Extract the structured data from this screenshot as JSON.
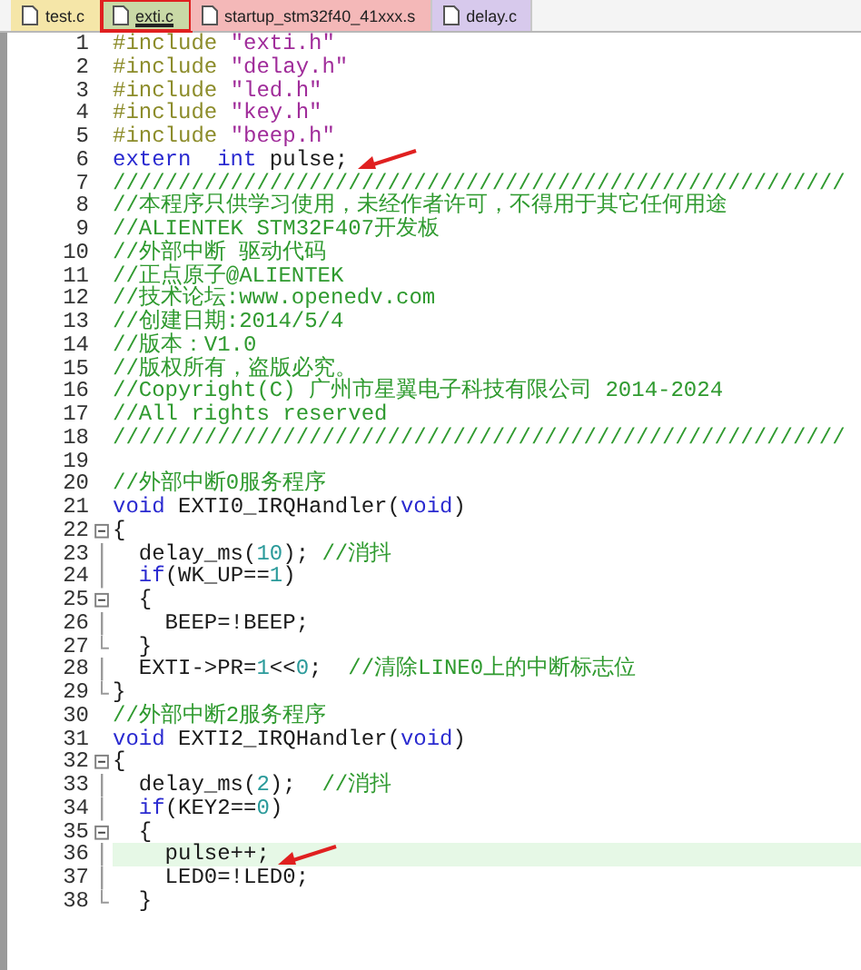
{
  "tabs": [
    {
      "label": "test.c",
      "selected": false,
      "color": "#f5e6a8",
      "boxed": false
    },
    {
      "label": "exti.c",
      "selected": true,
      "color": "#c9d9a6",
      "boxed": true
    },
    {
      "label": "startup_stm32f40_41xxx.s",
      "selected": false,
      "color": "#f4b8b8",
      "boxed": false
    },
    {
      "label": "delay.c",
      "selected": false,
      "color": "#d7c9ec",
      "boxed": false
    }
  ],
  "lines": [
    {
      "number": "1",
      "tokens": [
        {
          "kind": "preprocessor",
          "text": "#include "
        },
        {
          "kind": "string",
          "text": "\"exti.h\""
        }
      ]
    },
    {
      "number": "2",
      "tokens": [
        {
          "kind": "preprocessor",
          "text": "#include "
        },
        {
          "kind": "string",
          "text": "\"delay.h\""
        }
      ]
    },
    {
      "number": "3",
      "tokens": [
        {
          "kind": "preprocessor",
          "text": "#include "
        },
        {
          "kind": "string",
          "text": "\"led.h\""
        }
      ]
    },
    {
      "number": "4",
      "tokens": [
        {
          "kind": "preprocessor",
          "text": "#include "
        },
        {
          "kind": "string",
          "text": "\"key.h\""
        }
      ]
    },
    {
      "number": "5",
      "tokens": [
        {
          "kind": "preprocessor",
          "text": "#include "
        },
        {
          "kind": "string",
          "text": "\"beep.h\""
        }
      ]
    },
    {
      "number": "6",
      "arrow": true,
      "tokens": [
        {
          "kind": "keyword",
          "text": "extern  int"
        },
        {
          "kind": "plain",
          "text": " pulse;"
        }
      ]
    },
    {
      "number": "7",
      "tokens": [
        {
          "kind": "comment",
          "text": "////////////////////////////////////////////////////////"
        }
      ]
    },
    {
      "number": "8",
      "tokens": [
        {
          "kind": "comment",
          "text": "//本程序只供学习使用，未经作者许可，不得用于其它任何用途"
        }
      ]
    },
    {
      "number": "9",
      "tokens": [
        {
          "kind": "comment",
          "text": "//ALIENTEK STM32F407开发板"
        }
      ]
    },
    {
      "number": "10",
      "tokens": [
        {
          "kind": "comment",
          "text": "//外部中断 驱动代码"
        }
      ]
    },
    {
      "number": "11",
      "tokens": [
        {
          "kind": "comment",
          "text": "//正点原子@ALIENTEK"
        }
      ]
    },
    {
      "number": "12",
      "tokens": [
        {
          "kind": "comment",
          "text": "//技术论坛:www.openedv.com"
        }
      ]
    },
    {
      "number": "13",
      "tokens": [
        {
          "kind": "comment",
          "text": "//创建日期:2014/5/4"
        }
      ]
    },
    {
      "number": "14",
      "tokens": [
        {
          "kind": "comment",
          "text": "//版本：V1.0"
        }
      ]
    },
    {
      "number": "15",
      "tokens": [
        {
          "kind": "comment",
          "text": "//版权所有，盗版必究。"
        }
      ]
    },
    {
      "number": "16",
      "tokens": [
        {
          "kind": "comment",
          "text": "//Copyright(C) 广州市星翼电子科技有限公司 2014-2024"
        }
      ]
    },
    {
      "number": "17",
      "tokens": [
        {
          "kind": "comment",
          "text": "//All rights reserved"
        }
      ]
    },
    {
      "number": "18",
      "tokens": [
        {
          "kind": "comment",
          "text": "////////////////////////////////////////////////////////"
        }
      ]
    },
    {
      "number": "19"
    },
    {
      "number": "20",
      "tokens": [
        {
          "kind": "comment",
          "text": "//外部中断0服务程序"
        }
      ]
    },
    {
      "number": "21",
      "tokens": [
        {
          "kind": "keyword",
          "text": "void"
        },
        {
          "kind": "plain",
          "text": " EXTI0_IRQHandler("
        },
        {
          "kind": "keyword",
          "text": "void"
        },
        {
          "kind": "plain",
          "text": ")"
        }
      ]
    },
    {
      "number": "22",
      "fold_open": true,
      "tokens": [
        {
          "kind": "plain",
          "text": "{"
        }
      ]
    },
    {
      "number": "23",
      "fold_guide": true,
      "tokens": [
        {
          "kind": "plain",
          "text": "  delay_ms("
        },
        {
          "kind": "number",
          "text": "10"
        },
        {
          "kind": "plain",
          "text": "); "
        },
        {
          "kind": "comment",
          "text": "//消抖"
        }
      ]
    },
    {
      "number": "24",
      "fold_guide": true,
      "tokens": [
        {
          "kind": "keyword",
          "text": "  if"
        },
        {
          "kind": "plain",
          "text": "(WK_UP=="
        },
        {
          "kind": "number",
          "text": "1"
        },
        {
          "kind": "plain",
          "text": ")"
        }
      ]
    },
    {
      "number": "25",
      "fold_open": true,
      "tokens": [
        {
          "kind": "plain",
          "text": "  {"
        }
      ]
    },
    {
      "number": "26",
      "fold_guide": true,
      "tokens": [
        {
          "kind": "plain",
          "text": "    BEEP=!BEEP;"
        }
      ]
    },
    {
      "number": "27",
      "fold_end": true,
      "tokens": [
        {
          "kind": "plain",
          "text": "  }"
        }
      ]
    },
    {
      "number": "28",
      "fold_guide": true,
      "tokens": [
        {
          "kind": "plain",
          "text": "  EXTI->PR="
        },
        {
          "kind": "number",
          "text": "1"
        },
        {
          "kind": "plain",
          "text": "<<"
        },
        {
          "kind": "number",
          "text": "0"
        },
        {
          "kind": "plain",
          "text": ";  "
        },
        {
          "kind": "comment",
          "text": "//清除LINE0上的中断标志位"
        }
      ]
    },
    {
      "number": "29",
      "fold_end": true,
      "tokens": [
        {
          "kind": "plain",
          "text": "}"
        }
      ]
    },
    {
      "number": "30",
      "tokens": [
        {
          "kind": "comment",
          "text": "//外部中断2服务程序"
        }
      ]
    },
    {
      "number": "31",
      "tokens": [
        {
          "kind": "keyword",
          "text": "void"
        },
        {
          "kind": "plain",
          "text": " EXTI2_IRQHandler("
        },
        {
          "kind": "keyword",
          "text": "void"
        },
        {
          "kind": "plain",
          "text": ")"
        }
      ]
    },
    {
      "number": "32",
      "fold_open": true,
      "tokens": [
        {
          "kind": "plain",
          "text": "{"
        }
      ]
    },
    {
      "number": "33",
      "fold_guide": true,
      "tokens": [
        {
          "kind": "plain",
          "text": "  delay_ms("
        },
        {
          "kind": "number",
          "text": "2"
        },
        {
          "kind": "plain",
          "text": ");  "
        },
        {
          "kind": "comment",
          "text": "//消抖"
        }
      ]
    },
    {
      "number": "34",
      "fold_guide": true,
      "tokens": [
        {
          "kind": "keyword",
          "text": "  if"
        },
        {
          "kind": "plain",
          "text": "(KEY2=="
        },
        {
          "kind": "number",
          "text": "0"
        },
        {
          "kind": "plain",
          "text": ")"
        }
      ]
    },
    {
      "number": "35",
      "fold_open": true,
      "tokens": [
        {
          "kind": "plain",
          "text": "  {"
        }
      ]
    },
    {
      "number": "36",
      "fold_guide": true,
      "highlighted": true,
      "arrow": true,
      "tokens": [
        {
          "kind": "plain",
          "text": "    pulse++;"
        }
      ]
    },
    {
      "number": "37",
      "fold_guide": true,
      "tokens": [
        {
          "kind": "plain",
          "text": "    LED0=!LED0;"
        }
      ]
    },
    {
      "number": "38",
      "fold_end": true,
      "tokens": [
        {
          "kind": "plain",
          "text": "  }"
        }
      ]
    }
  ]
}
